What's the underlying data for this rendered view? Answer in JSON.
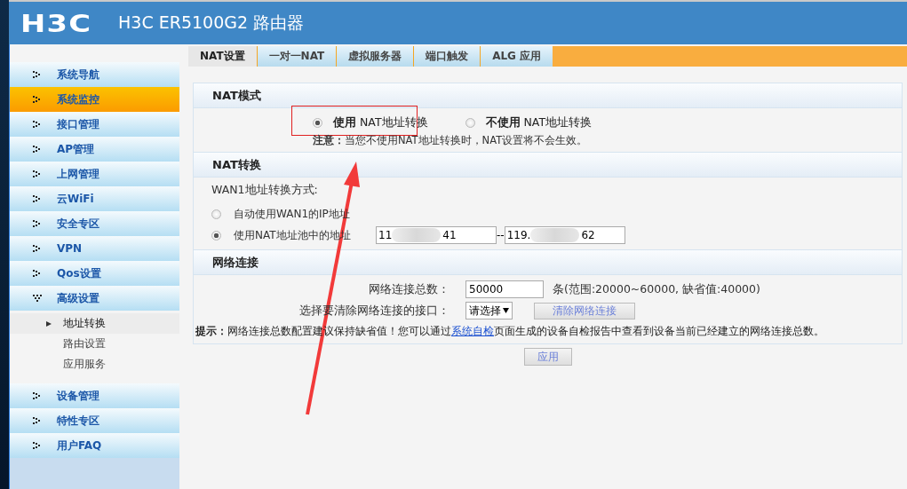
{
  "header": {
    "logo": "H3C",
    "title": "H3C ER5100G2 路由器"
  },
  "sidebar": {
    "items": [
      {
        "label": "系统导航",
        "selected": false,
        "expanded": false
      },
      {
        "label": "系统监控",
        "selected": true,
        "expanded": false
      },
      {
        "label": "接口管理",
        "selected": false,
        "expanded": false
      },
      {
        "label": "AP管理",
        "selected": false,
        "expanded": false
      },
      {
        "label": "上网管理",
        "selected": false,
        "expanded": false
      },
      {
        "label": "云WiFi",
        "selected": false,
        "expanded": false
      },
      {
        "label": "安全专区",
        "selected": false,
        "expanded": false
      },
      {
        "label": "VPN",
        "selected": false,
        "expanded": false
      },
      {
        "label": "Qos设置",
        "selected": false,
        "expanded": false
      },
      {
        "label": "高级设置",
        "selected": false,
        "expanded": true,
        "children": [
          {
            "label": "地址转换",
            "selected": true
          },
          {
            "label": "路由设置",
            "selected": false
          },
          {
            "label": "应用服务",
            "selected": false
          }
        ]
      },
      {
        "label": "设备管理",
        "selected": false,
        "expanded": false
      },
      {
        "label": "特性专区",
        "selected": false,
        "expanded": false
      },
      {
        "label": "用户FAQ",
        "selected": false,
        "expanded": false
      }
    ]
  },
  "tabs": [
    {
      "label": "NAT设置",
      "selected": true
    },
    {
      "label": "一对一NAT",
      "selected": false
    },
    {
      "label": "虚拟服务器",
      "selected": false
    },
    {
      "label": "端口触发",
      "selected": false
    },
    {
      "label": "ALG 应用",
      "selected": false
    }
  ],
  "nat_mode": {
    "title": "NAT模式",
    "options": [
      {
        "label": "**使用** NAT地址转换",
        "selected": true
      },
      {
        "label": "**不使用** NAT地址转换",
        "selected": false
      }
    ],
    "note": "**注意：**当您不使用NAT地址转换时，NAT设置将不会生效。"
  },
  "nat_conversion": {
    "title": "NAT转换",
    "method_label": "WAN1地址转换方式:",
    "options": [
      {
        "label": "自动使用WAN1的IP地址",
        "selected": false
      },
      {
        "label": "使用NAT地址池中的地址",
        "selected": true
      }
    ],
    "range_start": {
      "start": "11",
      "end": "41"
    },
    "separator": "--",
    "range_end": {
      "start": "119.",
      "end": "62"
    }
  },
  "network": {
    "title": "网络连接",
    "total_label": "网络连接总数：",
    "total_value": "50000",
    "total_hint": "条(范围:20000~60000, 缺省值:40000)",
    "clear_label": "选择要清除网络连接的接口：",
    "select": "请选择",
    "clear_button": "清除网络连接",
    "tip_prefix": "提示：",
    "tip_before": "网络连接总数配置建议保持缺省值！您可以通过",
    "tip_link": "系统自检",
    "tip_after": "页面生成的设备自检报告中查看到设备当前已经建立的网络连接总数。"
  },
  "apply_button": "应用"
}
